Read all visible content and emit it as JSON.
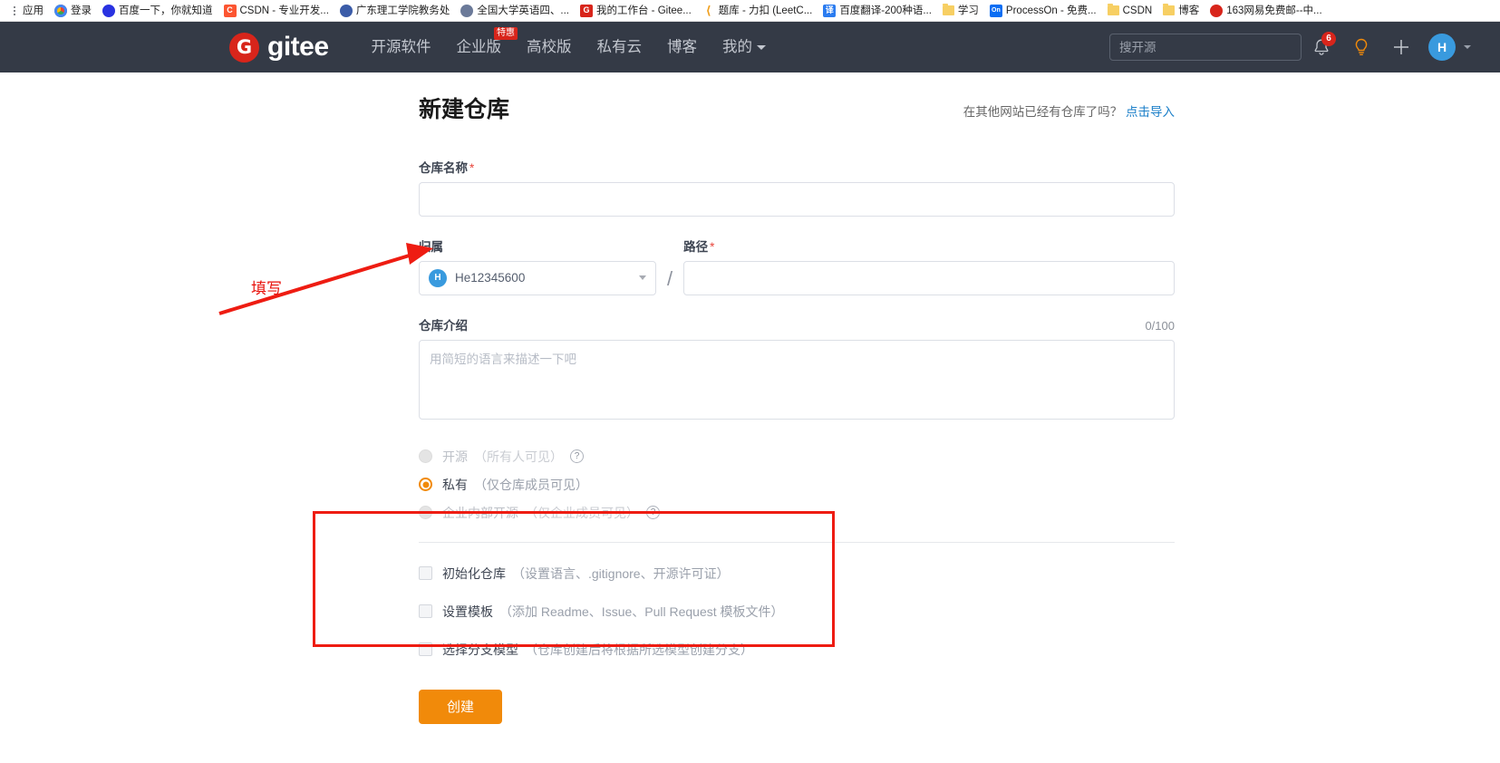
{
  "browser": {
    "bookmarks": [
      {
        "label": "应用",
        "icon": "apps-grid-icon",
        "color": "#5f6368",
        "glyph": "",
        "kind": "dots"
      },
      {
        "label": "登录",
        "icon": "login-icon",
        "color": "#7ac143",
        "glyph": "",
        "kind": "chrome"
      },
      {
        "label": "百度一下，你就知道",
        "icon": "baidu-icon",
        "color": "#2932e1",
        "glyph": "熊",
        "kind": "paw"
      },
      {
        "label": "CSDN - 专业开发...",
        "icon": "csdn-icon",
        "color": "#fc5531",
        "glyph": "C",
        "kind": "square"
      },
      {
        "label": "广东理工学院教务处",
        "icon": "school-icon",
        "color": "#3b5ca8",
        "glyph": "",
        "kind": "circle"
      },
      {
        "label": "全国大学英语四、...",
        "icon": "cet-icon",
        "color": "#6b7a99",
        "glyph": "",
        "kind": "circle"
      },
      {
        "label": "我的工作台 - Gitee...",
        "icon": "gitee-icon",
        "color": "#d8251b",
        "glyph": "G",
        "kind": "square"
      },
      {
        "label": "题库 - 力扣 (LeetC...",
        "icon": "leetcode-icon",
        "color": "#f0a020",
        "glyph": "",
        "kind": "leet"
      },
      {
        "label": "百度翻译-200种语...",
        "icon": "fanyi-icon",
        "color": "#2b7cf0",
        "glyph": "译",
        "kind": "square"
      },
      {
        "label": "学习",
        "icon": "folder-icon",
        "color": "#f7cf63",
        "glyph": "",
        "kind": "folder"
      },
      {
        "label": "ProcessOn - 免费...",
        "icon": "processon-icon",
        "color": "#0b6ef3",
        "glyph": "On",
        "kind": "square"
      },
      {
        "label": "CSDN",
        "icon": "folder-icon",
        "color": "#f7cf63",
        "glyph": "",
        "kind": "folder"
      },
      {
        "label": "博客",
        "icon": "folder-icon",
        "color": "#f7cf63",
        "glyph": "",
        "kind": "folder"
      },
      {
        "label": "163网易免费邮--中...",
        "icon": "netease-mail-icon",
        "color": "#d8251b",
        "glyph": "网",
        "kind": "paw"
      }
    ]
  },
  "header": {
    "logo_mark": "G",
    "logo_text": "gitee",
    "nav": [
      {
        "label": "开源软件",
        "badge": ""
      },
      {
        "label": "企业版",
        "badge": "特惠"
      },
      {
        "label": "高校版",
        "badge": ""
      },
      {
        "label": "私有云",
        "badge": ""
      },
      {
        "label": "博客",
        "badge": ""
      },
      {
        "label": "我的",
        "badge": "",
        "has_caret": true
      }
    ],
    "search_placeholder": "搜开源",
    "search_value": "",
    "notification_count": "6",
    "bell_icon": "bell-icon",
    "idea_icon": "lightbulb-icon",
    "plus_icon": "plus-icon",
    "avatar_initial": "H"
  },
  "form": {
    "title": "新建仓库",
    "import_prompt": "在其他网站已经有仓库了吗？",
    "import_link": "点击导入",
    "name": {
      "label": "仓库名称",
      "required": "*",
      "value": "",
      "placeholder": ""
    },
    "owner": {
      "label": "归属",
      "avatar_initial": "H",
      "value": "He12345600"
    },
    "separator": "/",
    "path": {
      "label": "路径",
      "required": "*",
      "value": "",
      "placeholder": ""
    },
    "description": {
      "label": "仓库介绍",
      "counter": "0/100",
      "value": "",
      "placeholder": "用简短的语言来描述一下吧"
    },
    "visibility": [
      {
        "main": "开源",
        "sub": "（所有人可见）",
        "selected": false,
        "disabled": true,
        "help": "?"
      },
      {
        "main": "私有",
        "sub": "（仅仓库成员可见）",
        "selected": true,
        "disabled": false,
        "help": ""
      },
      {
        "main": "企业内部开源",
        "sub": "（仅企业成员可见）",
        "selected": false,
        "disabled": true,
        "help": "?"
      }
    ],
    "options": [
      {
        "main": "初始化仓库",
        "sub": "（设置语言、.gitignore、开源许可证）",
        "checked": false
      },
      {
        "main": "设置模板",
        "sub": "（添加 Readme、Issue、Pull Request 模板文件）",
        "checked": false
      },
      {
        "main": "选择分支模型",
        "sub": "（仓库创建后将根据所选模型创建分支）",
        "checked": false
      }
    ],
    "submit_label": "创建"
  },
  "annotations": {
    "arrow_label": "填写",
    "arrow_color": "#e8110b",
    "box_color": "#ee1c12"
  }
}
